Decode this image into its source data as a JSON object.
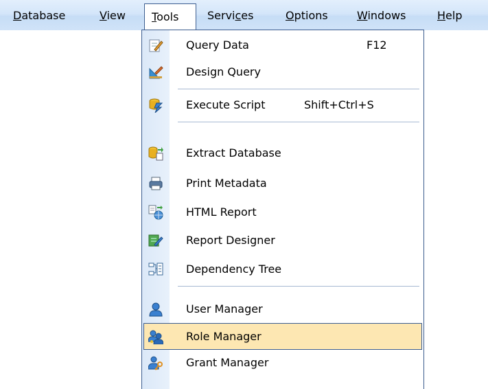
{
  "menubar": {
    "items": [
      {
        "label_pre": "",
        "label_ul": "D",
        "label_post": "atabase"
      },
      {
        "label_pre": "",
        "label_ul": "V",
        "label_post": "iew"
      },
      {
        "label_pre": "",
        "label_ul": "T",
        "label_post": "ools"
      },
      {
        "label_pre": "Servi",
        "label_ul": "c",
        "label_post": "es"
      },
      {
        "label_pre": "",
        "label_ul": "O",
        "label_post": "ptions"
      },
      {
        "label_pre": "",
        "label_ul": "W",
        "label_post": "indows"
      },
      {
        "label_pre": "",
        "label_ul": "H",
        "label_post": "elp"
      }
    ]
  },
  "tools_menu": {
    "items": [
      {
        "label": "Query Data",
        "shortcut": "F12",
        "icon": "query-data-icon"
      },
      {
        "label": "Design Query",
        "shortcut": "",
        "icon": "design-query-icon"
      },
      {
        "label": "Execute Script",
        "shortcut": "Shift+Ctrl+S",
        "icon": "execute-script-icon"
      },
      {
        "label": "Extract Database",
        "shortcut": "",
        "icon": "extract-database-icon"
      },
      {
        "label": "Print Metadata",
        "shortcut": "",
        "icon": "printer-icon"
      },
      {
        "label": "HTML Report",
        "shortcut": "",
        "icon": "html-report-icon"
      },
      {
        "label": "Report Designer",
        "shortcut": "",
        "icon": "report-designer-icon"
      },
      {
        "label": "Dependency Tree",
        "shortcut": "",
        "icon": "dependency-tree-icon"
      },
      {
        "label": "User Manager",
        "shortcut": "",
        "icon": "user-icon"
      },
      {
        "label": "Role Manager",
        "shortcut": "",
        "icon": "role-icon",
        "highlighted": true
      },
      {
        "label": "Grant Manager",
        "shortcut": "",
        "icon": "grant-icon"
      }
    ]
  },
  "colors": {
    "menubar_bg": "#d4e6fa",
    "border": "#3c5d8f",
    "highlight": "#fde7b2"
  }
}
